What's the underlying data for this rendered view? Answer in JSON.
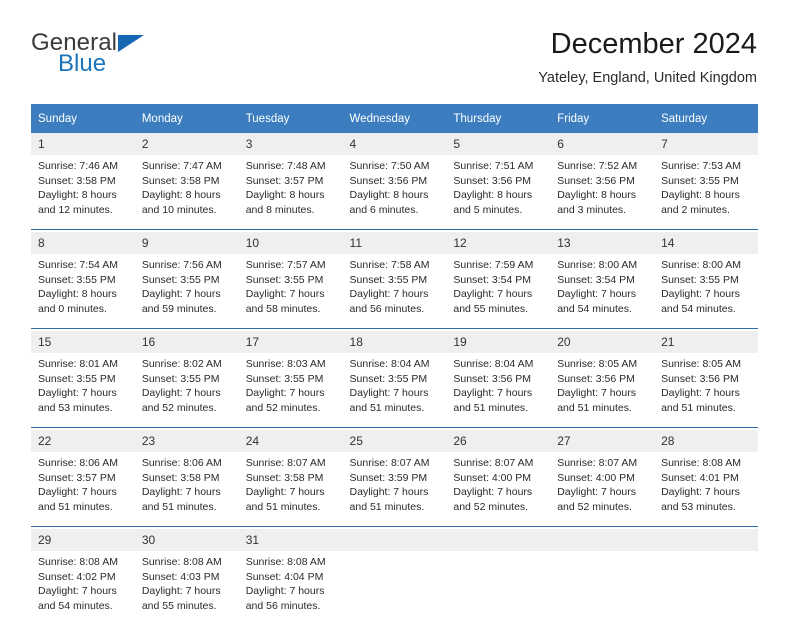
{
  "logo": {
    "word_one": "General",
    "word_two": "Blue",
    "triangle_icon": "triangle-icon",
    "brand_color": "#1b75bb",
    "brand_dark": "#3b3b3b"
  },
  "header": {
    "title": "December 2024",
    "subtitle": "Yateley, England, United Kingdom"
  },
  "calendar": {
    "header_bg": "#3b7dbf",
    "header_text_color": "#ffffff",
    "daynum_bg": "#efefef",
    "separator_color": "#2e6da4",
    "weekday_headers": [
      "Sunday",
      "Monday",
      "Tuesday",
      "Wednesday",
      "Thursday",
      "Friday",
      "Saturday"
    ],
    "weeks": [
      [
        {
          "day": "1",
          "sunrise": "Sunrise: 7:46 AM",
          "sunset": "Sunset: 3:58 PM",
          "daylight_1": "Daylight: 8 hours",
          "daylight_2": "and 12 minutes."
        },
        {
          "day": "2",
          "sunrise": "Sunrise: 7:47 AM",
          "sunset": "Sunset: 3:58 PM",
          "daylight_1": "Daylight: 8 hours",
          "daylight_2": "and 10 minutes."
        },
        {
          "day": "3",
          "sunrise": "Sunrise: 7:48 AM",
          "sunset": "Sunset: 3:57 PM",
          "daylight_1": "Daylight: 8 hours",
          "daylight_2": "and 8 minutes."
        },
        {
          "day": "4",
          "sunrise": "Sunrise: 7:50 AM",
          "sunset": "Sunset: 3:56 PM",
          "daylight_1": "Daylight: 8 hours",
          "daylight_2": "and 6 minutes."
        },
        {
          "day": "5",
          "sunrise": "Sunrise: 7:51 AM",
          "sunset": "Sunset: 3:56 PM",
          "daylight_1": "Daylight: 8 hours",
          "daylight_2": "and 5 minutes."
        },
        {
          "day": "6",
          "sunrise": "Sunrise: 7:52 AM",
          "sunset": "Sunset: 3:56 PM",
          "daylight_1": "Daylight: 8 hours",
          "daylight_2": "and 3 minutes."
        },
        {
          "day": "7",
          "sunrise": "Sunrise: 7:53 AM",
          "sunset": "Sunset: 3:55 PM",
          "daylight_1": "Daylight: 8 hours",
          "daylight_2": "and 2 minutes."
        }
      ],
      [
        {
          "day": "8",
          "sunrise": "Sunrise: 7:54 AM",
          "sunset": "Sunset: 3:55 PM",
          "daylight_1": "Daylight: 8 hours",
          "daylight_2": "and 0 minutes."
        },
        {
          "day": "9",
          "sunrise": "Sunrise: 7:56 AM",
          "sunset": "Sunset: 3:55 PM",
          "daylight_1": "Daylight: 7 hours",
          "daylight_2": "and 59 minutes."
        },
        {
          "day": "10",
          "sunrise": "Sunrise: 7:57 AM",
          "sunset": "Sunset: 3:55 PM",
          "daylight_1": "Daylight: 7 hours",
          "daylight_2": "and 58 minutes."
        },
        {
          "day": "11",
          "sunrise": "Sunrise: 7:58 AM",
          "sunset": "Sunset: 3:55 PM",
          "daylight_1": "Daylight: 7 hours",
          "daylight_2": "and 56 minutes."
        },
        {
          "day": "12",
          "sunrise": "Sunrise: 7:59 AM",
          "sunset": "Sunset: 3:54 PM",
          "daylight_1": "Daylight: 7 hours",
          "daylight_2": "and 55 minutes."
        },
        {
          "day": "13",
          "sunrise": "Sunrise: 8:00 AM",
          "sunset": "Sunset: 3:54 PM",
          "daylight_1": "Daylight: 7 hours",
          "daylight_2": "and 54 minutes."
        },
        {
          "day": "14",
          "sunrise": "Sunrise: 8:00 AM",
          "sunset": "Sunset: 3:55 PM",
          "daylight_1": "Daylight: 7 hours",
          "daylight_2": "and 54 minutes."
        }
      ],
      [
        {
          "day": "15",
          "sunrise": "Sunrise: 8:01 AM",
          "sunset": "Sunset: 3:55 PM",
          "daylight_1": "Daylight: 7 hours",
          "daylight_2": "and 53 minutes."
        },
        {
          "day": "16",
          "sunrise": "Sunrise: 8:02 AM",
          "sunset": "Sunset: 3:55 PM",
          "daylight_1": "Daylight: 7 hours",
          "daylight_2": "and 52 minutes."
        },
        {
          "day": "17",
          "sunrise": "Sunrise: 8:03 AM",
          "sunset": "Sunset: 3:55 PM",
          "daylight_1": "Daylight: 7 hours",
          "daylight_2": "and 52 minutes."
        },
        {
          "day": "18",
          "sunrise": "Sunrise: 8:04 AM",
          "sunset": "Sunset: 3:55 PM",
          "daylight_1": "Daylight: 7 hours",
          "daylight_2": "and 51 minutes."
        },
        {
          "day": "19",
          "sunrise": "Sunrise: 8:04 AM",
          "sunset": "Sunset: 3:56 PM",
          "daylight_1": "Daylight: 7 hours",
          "daylight_2": "and 51 minutes."
        },
        {
          "day": "20",
          "sunrise": "Sunrise: 8:05 AM",
          "sunset": "Sunset: 3:56 PM",
          "daylight_1": "Daylight: 7 hours",
          "daylight_2": "and 51 minutes."
        },
        {
          "day": "21",
          "sunrise": "Sunrise: 8:05 AM",
          "sunset": "Sunset: 3:56 PM",
          "daylight_1": "Daylight: 7 hours",
          "daylight_2": "and 51 minutes."
        }
      ],
      [
        {
          "day": "22",
          "sunrise": "Sunrise: 8:06 AM",
          "sunset": "Sunset: 3:57 PM",
          "daylight_1": "Daylight: 7 hours",
          "daylight_2": "and 51 minutes."
        },
        {
          "day": "23",
          "sunrise": "Sunrise: 8:06 AM",
          "sunset": "Sunset: 3:58 PM",
          "daylight_1": "Daylight: 7 hours",
          "daylight_2": "and 51 minutes."
        },
        {
          "day": "24",
          "sunrise": "Sunrise: 8:07 AM",
          "sunset": "Sunset: 3:58 PM",
          "daylight_1": "Daylight: 7 hours",
          "daylight_2": "and 51 minutes."
        },
        {
          "day": "25",
          "sunrise": "Sunrise: 8:07 AM",
          "sunset": "Sunset: 3:59 PM",
          "daylight_1": "Daylight: 7 hours",
          "daylight_2": "and 51 minutes."
        },
        {
          "day": "26",
          "sunrise": "Sunrise: 8:07 AM",
          "sunset": "Sunset: 4:00 PM",
          "daylight_1": "Daylight: 7 hours",
          "daylight_2": "and 52 minutes."
        },
        {
          "day": "27",
          "sunrise": "Sunrise: 8:07 AM",
          "sunset": "Sunset: 4:00 PM",
          "daylight_1": "Daylight: 7 hours",
          "daylight_2": "and 52 minutes."
        },
        {
          "day": "28",
          "sunrise": "Sunrise: 8:08 AM",
          "sunset": "Sunset: 4:01 PM",
          "daylight_1": "Daylight: 7 hours",
          "daylight_2": "and 53 minutes."
        }
      ],
      [
        {
          "day": "29",
          "sunrise": "Sunrise: 8:08 AM",
          "sunset": "Sunset: 4:02 PM",
          "daylight_1": "Daylight: 7 hours",
          "daylight_2": "and 54 minutes."
        },
        {
          "day": "30",
          "sunrise": "Sunrise: 8:08 AM",
          "sunset": "Sunset: 4:03 PM",
          "daylight_1": "Daylight: 7 hours",
          "daylight_2": "and 55 minutes."
        },
        {
          "day": "31",
          "sunrise": "Sunrise: 8:08 AM",
          "sunset": "Sunset: 4:04 PM",
          "daylight_1": "Daylight: 7 hours",
          "daylight_2": "and 56 minutes."
        },
        {
          "day": "",
          "sunrise": "",
          "sunset": "",
          "daylight_1": "",
          "daylight_2": ""
        },
        {
          "day": "",
          "sunrise": "",
          "sunset": "",
          "daylight_1": "",
          "daylight_2": ""
        },
        {
          "day": "",
          "sunrise": "",
          "sunset": "",
          "daylight_1": "",
          "daylight_2": ""
        },
        {
          "day": "",
          "sunrise": "",
          "sunset": "",
          "daylight_1": "",
          "daylight_2": ""
        }
      ]
    ]
  }
}
